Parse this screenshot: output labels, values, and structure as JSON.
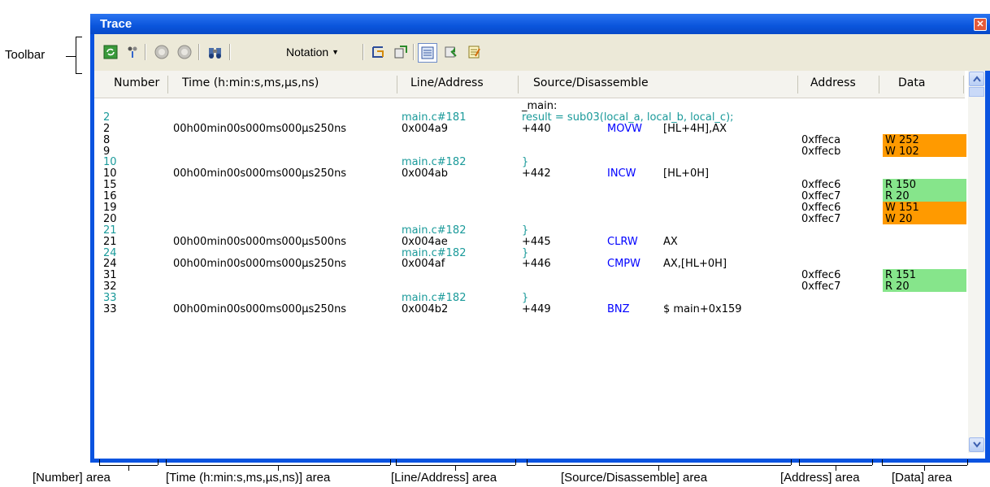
{
  "annotations": {
    "toolbar": "Toolbar",
    "areas": [
      "[Number] area",
      "[Time (h:min:s,ms,µs,ns)] area",
      "[Line/Address] area",
      "[Source/Disassemble] area",
      "[Address] area",
      "[Data] area"
    ]
  },
  "window": {
    "title": "Trace"
  },
  "toolbar": {
    "notation_label": "Notation"
  },
  "columns": [
    "Number",
    "Time (h:min:s,ms,µs,ns)",
    "Line/Address",
    "Source/Disassemble",
    "Address",
    "Data"
  ],
  "rows": [
    {
      "num": "",
      "time": "",
      "line": "",
      "src": "_main:"
    },
    {
      "num": "2",
      "line": "main.c#181",
      "src": "result = sub03(local_a, local_b, local_c);",
      "kind": "source"
    },
    {
      "num": "2",
      "time": "00h00min00s000ms000µs250ns",
      "line": "0x004a9",
      "off": "+440",
      "mn": "MOVW",
      "op": "[HL+4H],AX"
    },
    {
      "num": "8",
      "addr": "0xffeca",
      "data": "W 252",
      "dk": "w"
    },
    {
      "num": "9",
      "addr": "0xffecb",
      "data": "W 102",
      "dk": "w"
    },
    {
      "num": "10",
      "line": "main.c#182",
      "src": "}",
      "kind": "source"
    },
    {
      "num": "10",
      "time": "00h00min00s000ms000µs250ns",
      "line": "0x004ab",
      "off": "+442",
      "mn": "INCW",
      "op": "[HL+0H]"
    },
    {
      "num": "15",
      "addr": "0xffec6",
      "data": "R 150",
      "dk": "r"
    },
    {
      "num": "16",
      "addr": "0xffec7",
      "data": "R 20",
      "dk": "r"
    },
    {
      "num": "19",
      "addr": "0xffec6",
      "data": "W 151",
      "dk": "w"
    },
    {
      "num": "20",
      "addr": "0xffec7",
      "data": "W 20",
      "dk": "w"
    },
    {
      "num": "21",
      "line": "main.c#182",
      "src": "}",
      "kind": "source"
    },
    {
      "num": "21",
      "time": "00h00min00s000ms000µs500ns",
      "line": "0x004ae",
      "off": "+445",
      "mn": "CLRW",
      "op": "AX"
    },
    {
      "num": "24",
      "line": "main.c#182",
      "src": "}",
      "kind": "source"
    },
    {
      "num": "24",
      "time": "00h00min00s000ms000µs250ns",
      "line": "0x004af",
      "off": "+446",
      "mn": "CMPW",
      "op": "AX,[HL+0H]"
    },
    {
      "num": "31",
      "addr": "0xffec6",
      "data": "R 151",
      "dk": "r"
    },
    {
      "num": "32",
      "addr": "0xffec7",
      "data": "R 20",
      "dk": "r"
    },
    {
      "num": "33",
      "line": "main.c#182",
      "src": "}",
      "kind": "source"
    },
    {
      "num": "33",
      "time": "00h00min00s000ms000µs250ns",
      "line": "0x004b2",
      "off": "+449",
      "mn": "BNZ",
      "op": "$ main+0x159"
    }
  ],
  "colors": {
    "title_bar": "#0a53e0",
    "write": "#ff9a00",
    "read": "#86e58b",
    "source_text": "#1a9a9a",
    "mnemonic": "#0000ff"
  }
}
